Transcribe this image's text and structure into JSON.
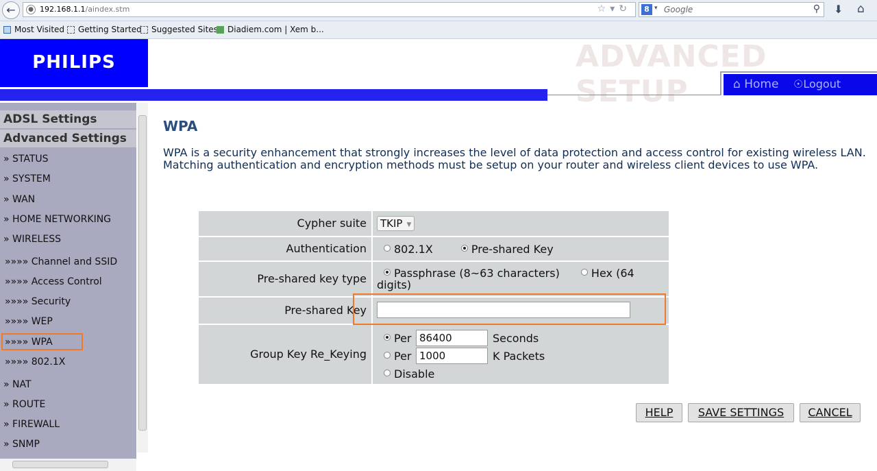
{
  "browser": {
    "url_host": "192.168.1.1",
    "url_path": "/aindex.stm",
    "search_placeholder": "Google",
    "bookmarks": [
      "Most Visited",
      "Getting Started",
      "Suggested Sites",
      "Diadiem.com | Xem b..."
    ]
  },
  "header": {
    "logo": "PHILIPS",
    "banner": "ADVANCED SETUP",
    "home": "Home",
    "logout": "Logout"
  },
  "menu": {
    "sections": [
      "ADSL Settings",
      "Advanced Settings"
    ],
    "items": [
      "» STATUS",
      "» SYSTEM",
      "» WAN",
      "» HOME NETWORKING",
      "» WIRELESS"
    ],
    "wireless_sub": [
      "»»»» Channel and SSID",
      "»»»» Access Control",
      "»»»» Security",
      "»»»» WEP",
      "»»»» WPA",
      "»»»» 802.1X"
    ],
    "items2": [
      "» NAT",
      "» ROUTE",
      "» FIREWALL",
      "» SNMP"
    ]
  },
  "content": {
    "title": "WPA",
    "description": "WPA is a security enhancement that strongly increases the level of data protection and access control for existing wireless LAN. Matching authentication and encryption methods must be setup on your router and wireless client devices to use WPA.",
    "form": {
      "cypher_label": "Cypher suite",
      "cypher_value": "TKIP",
      "auth_label": "Authentication",
      "auth_opt1": "802.1X",
      "auth_opt2": "Pre-shared Key",
      "psk_type_label": "Pre-shared key type",
      "psk_type_opt1": "Passphrase (8~63 characters)",
      "psk_type_opt2": "Hex (64",
      "psk_type_opt2b": "digits)",
      "psk_label": "Pre-shared Key",
      "psk_value": "",
      "rekey_label": "Group Key Re_Keying",
      "rekey_per": "Per",
      "rekey_seconds_value": "86400",
      "rekey_seconds_unit": "Seconds",
      "rekey_packets_value": "1000",
      "rekey_packets_unit": "K Packets",
      "rekey_disable": "Disable"
    },
    "buttons": {
      "help": "HELP",
      "save": "SAVE SETTINGS",
      "cancel": "CANCEL"
    }
  }
}
